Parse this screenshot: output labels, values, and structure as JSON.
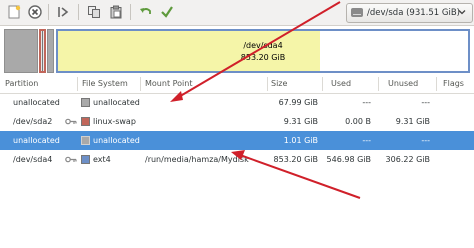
{
  "toolbar": {
    "device_label": "/dev/sda  (931.51 GiB)"
  },
  "graph": {
    "ext4_name": "/dev/sda4",
    "ext4_size": "853.20 GiB",
    "ext4_used_fraction": 0.64
  },
  "table": {
    "headers": [
      "Partition",
      "File System",
      "Mount Point",
      "Size",
      "Used",
      "Unused",
      "Flags"
    ],
    "rows": [
      {
        "partition": "unallocated",
        "fs": "unallocated",
        "mount": "",
        "size": "67.99 GiB",
        "used": "---",
        "unused": "---",
        "flags": ""
      },
      {
        "partition": "/dev/sda2",
        "fs": "linux-swap",
        "mount": "",
        "size": "9.31 GiB",
        "used": "0.00 B",
        "unused": "9.31 GiB",
        "flags": ""
      },
      {
        "partition": "unallocated",
        "fs": "unallocated",
        "mount": "",
        "size": "1.01 GiB",
        "used": "---",
        "unused": "---",
        "flags": ""
      },
      {
        "partition": "/dev/sda4",
        "fs": "ext4",
        "mount": "/run/media/hamza/Mydisk",
        "size": "853.20 GiB",
        "used": "546.98 GiB",
        "unused": "306.22 GiB",
        "flags": ""
      }
    ]
  },
  "colors": {
    "selection": "#4a90d9",
    "unallocated": "#a9a9a9",
    "linux_swap": "#c1665a",
    "ext4": "#6d8fc7",
    "used_space": "#f5f5a8",
    "annotation_arrow": "#d0202a"
  },
  "icons": [
    "new-document-icon",
    "delete-icon",
    "apply-icon",
    "copy-icon",
    "paste-icon",
    "undo-icon",
    "checkmark-icon",
    "disk-icon",
    "chevron-down-icon",
    "key-icon"
  ]
}
